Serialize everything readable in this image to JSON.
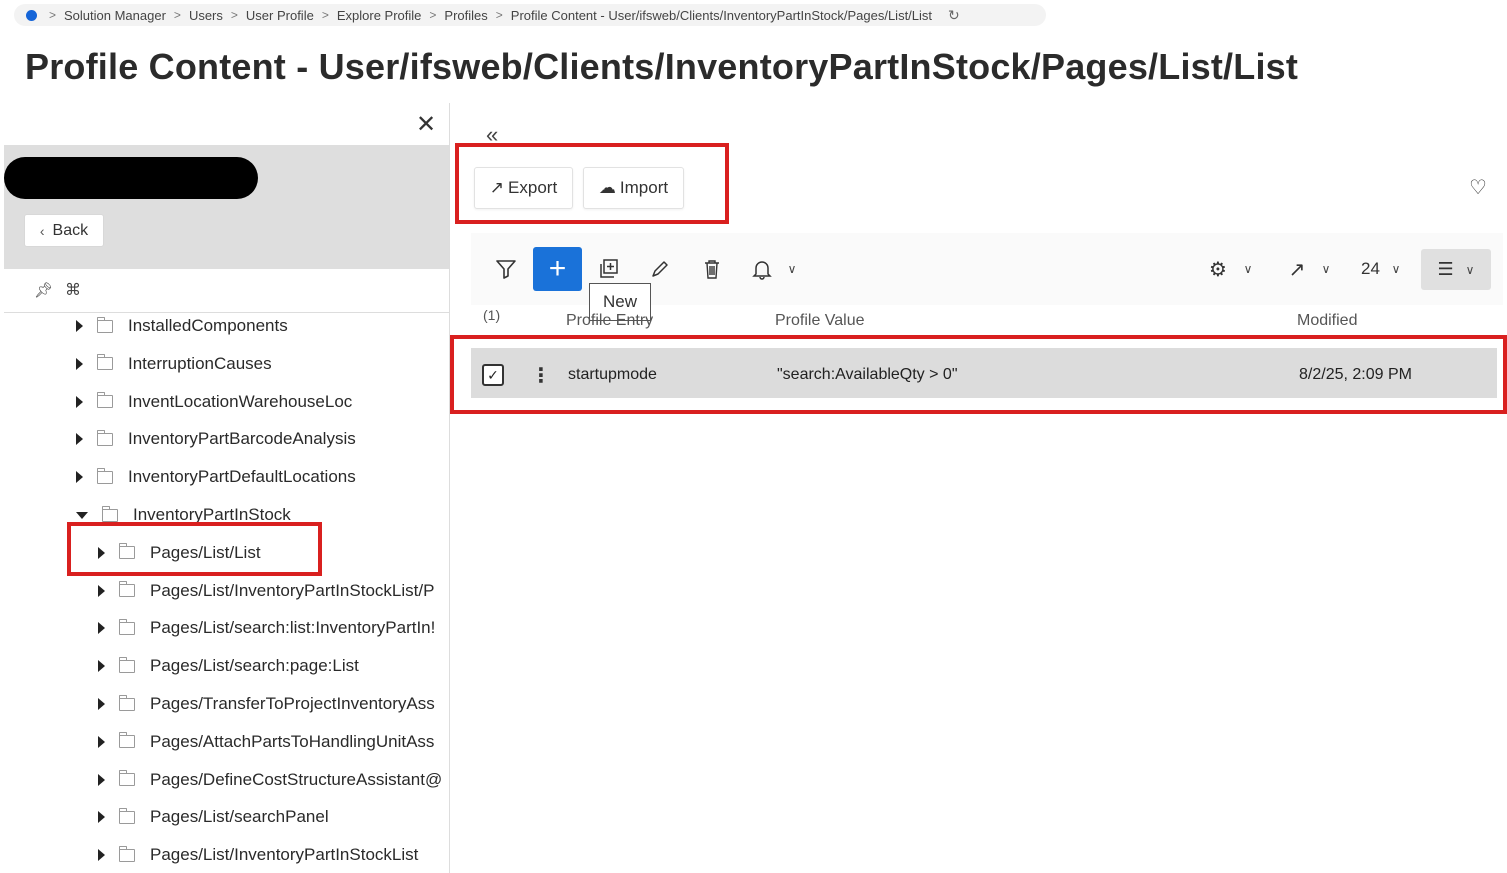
{
  "breadcrumb": {
    "items": [
      "Solution Manager",
      "Users",
      "User Profile",
      "Explore Profile",
      "Profiles",
      "Profile Content - User/ifsweb/Clients/InventoryPartInStock/Pages/List/List"
    ]
  },
  "page_title": "Profile Content - User/ifsweb/Clients/InventoryPartInStock/Pages/List/List",
  "left_panel": {
    "back_label": "Back",
    "tree": [
      {
        "label": "InstalledComponents",
        "level": 0,
        "expanded": false
      },
      {
        "label": "InterruptionCauses",
        "level": 0,
        "expanded": false
      },
      {
        "label": "InventLocationWarehouseLoc",
        "level": 0,
        "expanded": false
      },
      {
        "label": "InventoryPartBarcodeAnalysis",
        "level": 0,
        "expanded": false
      },
      {
        "label": "InventoryPartDefaultLocations",
        "level": 0,
        "expanded": false
      },
      {
        "label": "InventoryPartInStock",
        "level": 0,
        "expanded": true
      },
      {
        "label": "Pages/List/List",
        "level": 1,
        "expanded": false,
        "selected": true
      },
      {
        "label": "Pages/List/InventoryPartInStockList/P",
        "level": 1,
        "expanded": false
      },
      {
        "label": "Pages/List/search:list:InventoryPartIn!",
        "level": 1,
        "expanded": false
      },
      {
        "label": "Pages/List/search:page:List",
        "level": 1,
        "expanded": false
      },
      {
        "label": "Pages/TransferToProjectInventoryAss",
        "level": 1,
        "expanded": false
      },
      {
        "label": "Pages/AttachPartsToHandlingUnitAss",
        "level": 1,
        "expanded": false
      },
      {
        "label": "Pages/DefineCostStructureAssistant@",
        "level": 1,
        "expanded": false
      },
      {
        "label": "Pages/List/searchPanel",
        "level": 1,
        "expanded": false
      },
      {
        "label": "Pages/List/InventoryPartInStockList",
        "level": 1,
        "expanded": false
      }
    ]
  },
  "actions": {
    "export_label": "Export",
    "import_label": "Import"
  },
  "grid": {
    "tooltip": "New",
    "page_size": "24",
    "record_count": "(1)",
    "columns": [
      "Profile Entry",
      "Profile Value",
      "Modified"
    ],
    "rows": [
      {
        "entry": "startupmode",
        "value": "\"search:AvailableQty > 0\"",
        "modified": "8/2/25, 2:09 PM",
        "checked": true
      }
    ]
  },
  "colors": {
    "accent": "#1a72d9",
    "highlight": "#d9201f",
    "row_selected": "#dcdcdc"
  },
  "icons": [
    "home-dot-icon",
    "refresh-icon",
    "close-icon",
    "pin-icon",
    "columns-icon",
    "collapse-left-icon",
    "export-icon",
    "import-icon",
    "heart-icon",
    "filter-icon",
    "plus-icon",
    "duplicate-icon",
    "edit-icon",
    "delete-icon",
    "bell-icon",
    "gear-icon",
    "share-icon",
    "list-layout-icon",
    "kebab-icon",
    "check-icon"
  ]
}
